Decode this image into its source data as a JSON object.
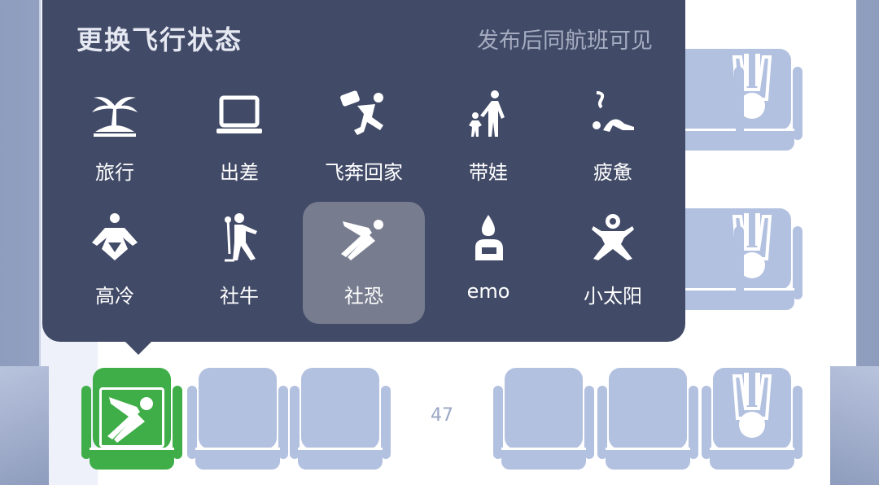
{
  "popup": {
    "title": "更换飞行状态",
    "hint": "发布后同航班可见",
    "statuses": [
      {
        "label": "旅行",
        "icon": "palm-tree-icon"
      },
      {
        "label": "出差",
        "icon": "laptop-icon"
      },
      {
        "label": "飞奔回家",
        "icon": "running-with-luggage-icon"
      },
      {
        "label": "带娃",
        "icon": "parent-with-child-icon"
      },
      {
        "label": "疲惫",
        "icon": "exhausted-person-icon"
      },
      {
        "label": "高冷",
        "icon": "cross-legged-person-icon"
      },
      {
        "label": "社牛",
        "icon": "singing-person-icon"
      },
      {
        "label": "社恐",
        "icon": "sliding-person-icon",
        "selected": true
      },
      {
        "label": "emo",
        "icon": "hugging-knees-person-icon"
      },
      {
        "label": "小太阳",
        "icon": "sun-flower-person-icon"
      }
    ]
  },
  "cabin": {
    "row_number": "47"
  },
  "colors": {
    "popup_bg": "#414a67",
    "selected_bg": "#777c8f",
    "my_seat": "#3fae49",
    "seat": "#b3c1e0"
  }
}
